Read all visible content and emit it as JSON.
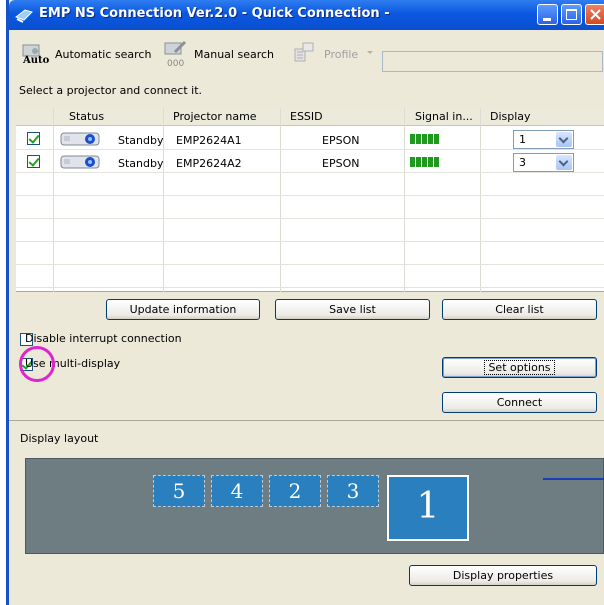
{
  "window": {
    "title": "EMP NS Connection Ver.2.0 - Quick Connection -"
  },
  "toolbar": {
    "automatic_search": "Automatic search",
    "automatic_sub": "Auto",
    "manual_search": "Manual search",
    "profile": "Profile"
  },
  "instruction": "Select a projector and connect it.",
  "table": {
    "columns": [
      "Status",
      "Projector name",
      "ESSID",
      "Signal in...",
      "Display"
    ],
    "rows": [
      {
        "checked": true,
        "status": "Standby",
        "name": "EMP2624A1",
        "essid": "EPSON",
        "signal_bars": 5,
        "display": "1"
      },
      {
        "checked": true,
        "status": "Standby",
        "name": "EMP2624A2",
        "essid": "EPSON",
        "signal_bars": 5,
        "display": "3"
      }
    ]
  },
  "buttons": {
    "update": "Update information",
    "save_list": "Save list",
    "clear_list": "Clear list",
    "set_options": "Set options",
    "connect": "Connect",
    "display_properties": "Display properties"
  },
  "options": {
    "disable_interrupt": {
      "label": "Disable interrupt connection",
      "checked": false
    },
    "multi_display": {
      "label": "Use multi-display",
      "checked": true
    }
  },
  "display_layout": {
    "label": "Display layout",
    "slots": [
      "5",
      "4",
      "2",
      "3"
    ],
    "main": "1"
  },
  "colors": {
    "titlebar": "#0b58e0",
    "panel": "#ece9d8",
    "layout_bg": "#6e7d82",
    "display_tile": "#2a7fbf",
    "highlight_circle": "#e024d0",
    "signal": "#1f9a1f"
  },
  "icons": [
    "app-icon",
    "minimize-icon",
    "maximize-icon",
    "close-icon",
    "auto-search-icon",
    "manual-search-icon",
    "profile-icon",
    "projector-icon",
    "dropdown-arrow-icon"
  ]
}
